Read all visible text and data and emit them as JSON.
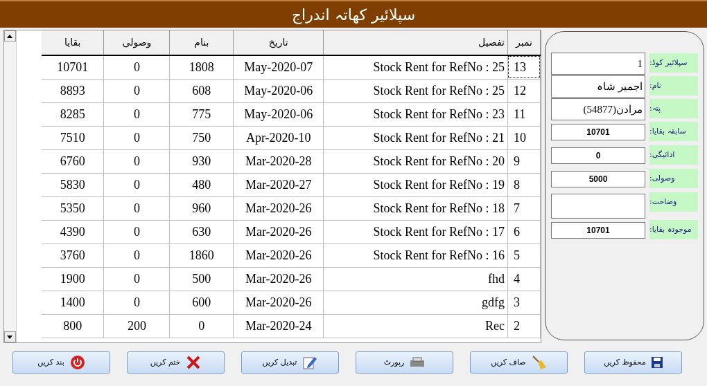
{
  "title": "سپلائیر کھاتہ اندراج",
  "table": {
    "columns": [
      "نمبر",
      "تفصیل",
      "تاریخ",
      "بنام",
      "وصولی",
      "بقایا"
    ],
    "rows": [
      {
        "cells": [
          "13",
          "Stock Rent for RefNo : 25",
          "May-2020-07",
          "1808",
          "0",
          "10701"
        ],
        "selected": true
      },
      {
        "cells": [
          "12",
          "Stock Rent for RefNo : 25",
          "May-2020-06",
          "608",
          "0",
          "8893"
        ],
        "selected": false
      },
      {
        "cells": [
          "11",
          "Stock Rent for RefNo : 23",
          "May-2020-06",
          "775",
          "0",
          "8285"
        ],
        "selected": false
      },
      {
        "cells": [
          "10",
          "Stock Rent for RefNo : 21",
          "Apr-2020-10",
          "750",
          "0",
          "7510"
        ],
        "selected": false
      },
      {
        "cells": [
          "9",
          "Stock Rent for RefNo : 20",
          "Mar-2020-28",
          "930",
          "0",
          "6760"
        ],
        "selected": false
      },
      {
        "cells": [
          "8",
          "Stock Rent for RefNo : 19",
          "Mar-2020-27",
          "480",
          "0",
          "5830"
        ],
        "selected": false
      },
      {
        "cells": [
          "7",
          "Stock Rent for RefNo : 18",
          "Mar-2020-26",
          "960",
          "0",
          "5350"
        ],
        "selected": false
      },
      {
        "cells": [
          "6",
          "Stock Rent for RefNo : 17",
          "Mar-2020-26",
          "630",
          "0",
          "4390"
        ],
        "selected": false
      },
      {
        "cells": [
          "5",
          "Stock Rent for RefNo : 16",
          "Mar-2020-26",
          "1860",
          "0",
          "3760"
        ],
        "selected": false
      },
      {
        "cells": [
          "4",
          "fhd",
          "Mar-2020-26",
          "500",
          "0",
          "1900"
        ],
        "selected": false
      },
      {
        "cells": [
          "3",
          "gdfg",
          "Mar-2020-26",
          "600",
          "0",
          "1400"
        ],
        "selected": false
      },
      {
        "cells": [
          "2",
          "Rec",
          "Mar-2020-24",
          "0",
          "200",
          "800"
        ],
        "selected": false
      }
    ]
  },
  "form": [
    {
      "label": "سپلائیر کوڈ:",
      "value": "1",
      "kind": "big"
    },
    {
      "label": "نام:",
      "value": "اجمیر شاہ",
      "kind": "big"
    },
    {
      "label": "پتہ:",
      "value": "مرادن(54877)",
      "kind": "big"
    },
    {
      "label": "سابقہ بقایا:",
      "value": "10701",
      "kind": "bold"
    },
    {
      "label": "ادائیگی:",
      "value": "0",
      "kind": "bold"
    },
    {
      "label": "وصولی:",
      "value": "5000",
      "kind": "bold"
    },
    {
      "label": "وضاحت:",
      "kind": "tall"
    },
    {
      "label": "موجودہ بقایا:",
      "value": "10701",
      "kind": "bold"
    }
  ],
  "buttons": [
    {
      "label": "محفوظ کریں",
      "kind": "save"
    },
    {
      "label": "صاف کریں",
      "kind": "broom"
    },
    {
      "label": "رپورٹ",
      "kind": "printer"
    },
    {
      "label": "تبدیل کریں",
      "kind": "edit"
    },
    {
      "label": "ختم کریں",
      "kind": "cross"
    },
    {
      "label": "بند کریں",
      "kind": "power"
    }
  ]
}
